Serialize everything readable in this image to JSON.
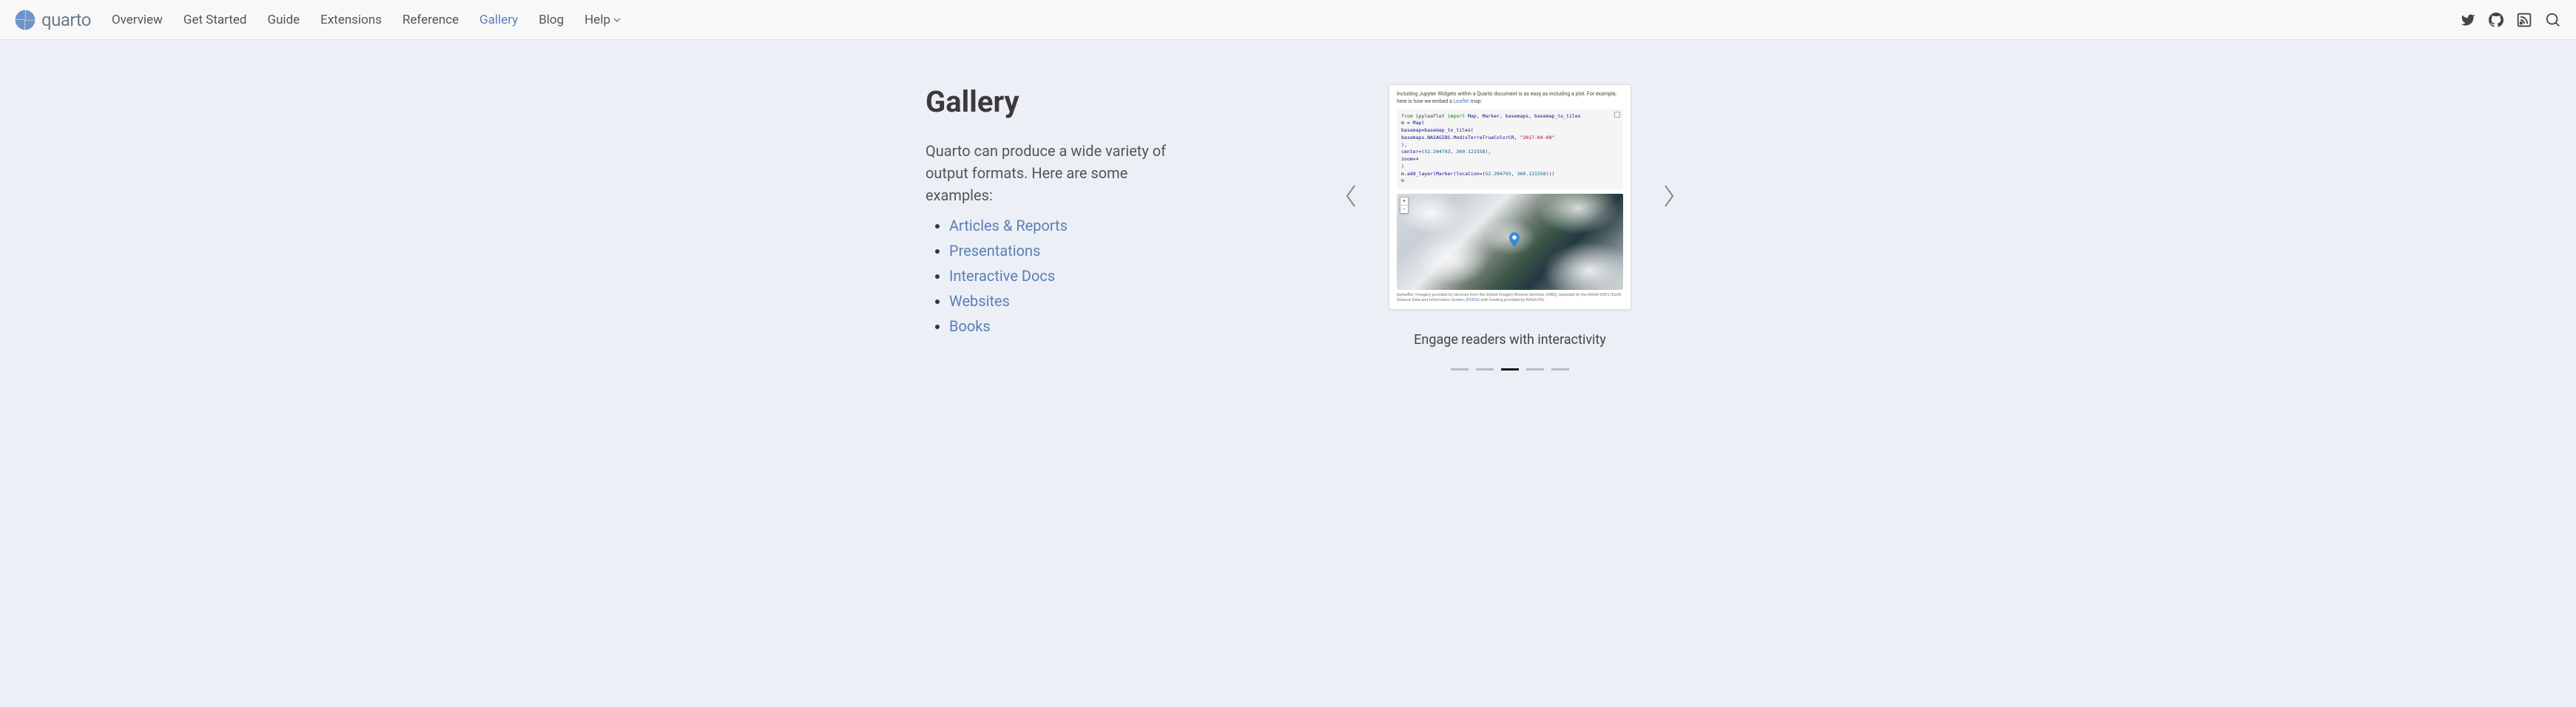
{
  "brand": {
    "name": "quarto"
  },
  "nav": {
    "items": [
      {
        "label": "Overview"
      },
      {
        "label": "Get Started"
      },
      {
        "label": "Guide"
      },
      {
        "label": "Extensions"
      },
      {
        "label": "Reference"
      },
      {
        "label": "Gallery",
        "active": true
      },
      {
        "label": "Blog"
      },
      {
        "label": "Help"
      }
    ]
  },
  "page": {
    "title": "Gallery",
    "intro": "Quarto can produce a wide variety of output formats. Here are some examples:",
    "links": [
      {
        "label": "Articles & Reports"
      },
      {
        "label": "Presentations"
      },
      {
        "label": "Interactive Docs"
      },
      {
        "label": "Websites"
      },
      {
        "label": "Books"
      }
    ]
  },
  "carousel": {
    "caption": "Engage readers with interactivity",
    "active_index": 2,
    "total": 5,
    "card": {
      "intro_prefix": "Including Jupyter Widgets within a Quarto document is as easy as including a plot. For example, here is how we embed a ",
      "intro_link": "Leaflet",
      "intro_suffix": " map:",
      "code": {
        "l1_kw_from": "from",
        "l1_mod": " ipyleaflet ",
        "l1_kw_import": "import",
        "l1_names": " Map, Marker, basemaps, basemap_to_tiles",
        "l2": "m = Map(",
        "l3_pad": "    basemap=basemap_to_tiles(",
        "l4_pad": "        basemaps.NASAGIBS.ModisTerraTrueColorCR, ",
        "l4_str": "\"2017-04-08\"",
        "l5_pad": "    ),",
        "l6_pad": "    center=(",
        "l6_n1": "52.204793",
        "l6_c": ", ",
        "l6_n2": "360.121558",
        "l6_end": "),",
        "l7_pad": "    zoom=",
        "l7_n": "4",
        "l8": ")",
        "l9_pre": "m.add_layer(Marker(location=(",
        "l9_n1": "52.204793",
        "l9_c": ", ",
        "l9_n2": "360.121558",
        "l9_end": ")))",
        "l10": "m"
      },
      "footer_prefix": "ipyleaflet | Imagery provided by services from the Global Imagery Browse Services (GIBS), operated by the NASA/GSFC/Earth Science Data and Information System (",
      "footer_link": "ESDIS",
      "footer_suffix": ") with funding provided by NASA/HQ."
    }
  },
  "map_controls": {
    "zoom_in": "+",
    "zoom_out": "−"
  }
}
